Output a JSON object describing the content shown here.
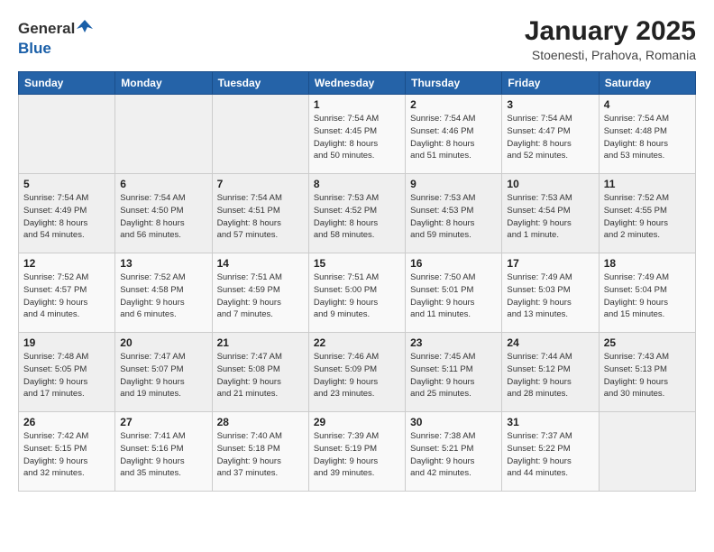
{
  "header": {
    "logo_general": "General",
    "logo_blue": "Blue",
    "title": "January 2025",
    "subtitle": "Stoenesti, Prahova, Romania"
  },
  "weekdays": [
    "Sunday",
    "Monday",
    "Tuesday",
    "Wednesday",
    "Thursday",
    "Friday",
    "Saturday"
  ],
  "weeks": [
    [
      {
        "day": "",
        "info": ""
      },
      {
        "day": "",
        "info": ""
      },
      {
        "day": "",
        "info": ""
      },
      {
        "day": "1",
        "info": "Sunrise: 7:54 AM\nSunset: 4:45 PM\nDaylight: 8 hours\nand 50 minutes."
      },
      {
        "day": "2",
        "info": "Sunrise: 7:54 AM\nSunset: 4:46 PM\nDaylight: 8 hours\nand 51 minutes."
      },
      {
        "day": "3",
        "info": "Sunrise: 7:54 AM\nSunset: 4:47 PM\nDaylight: 8 hours\nand 52 minutes."
      },
      {
        "day": "4",
        "info": "Sunrise: 7:54 AM\nSunset: 4:48 PM\nDaylight: 8 hours\nand 53 minutes."
      }
    ],
    [
      {
        "day": "5",
        "info": "Sunrise: 7:54 AM\nSunset: 4:49 PM\nDaylight: 8 hours\nand 54 minutes."
      },
      {
        "day": "6",
        "info": "Sunrise: 7:54 AM\nSunset: 4:50 PM\nDaylight: 8 hours\nand 56 minutes."
      },
      {
        "day": "7",
        "info": "Sunrise: 7:54 AM\nSunset: 4:51 PM\nDaylight: 8 hours\nand 57 minutes."
      },
      {
        "day": "8",
        "info": "Sunrise: 7:53 AM\nSunset: 4:52 PM\nDaylight: 8 hours\nand 58 minutes."
      },
      {
        "day": "9",
        "info": "Sunrise: 7:53 AM\nSunset: 4:53 PM\nDaylight: 8 hours\nand 59 minutes."
      },
      {
        "day": "10",
        "info": "Sunrise: 7:53 AM\nSunset: 4:54 PM\nDaylight: 9 hours\nand 1 minute."
      },
      {
        "day": "11",
        "info": "Sunrise: 7:52 AM\nSunset: 4:55 PM\nDaylight: 9 hours\nand 2 minutes."
      }
    ],
    [
      {
        "day": "12",
        "info": "Sunrise: 7:52 AM\nSunset: 4:57 PM\nDaylight: 9 hours\nand 4 minutes."
      },
      {
        "day": "13",
        "info": "Sunrise: 7:52 AM\nSunset: 4:58 PM\nDaylight: 9 hours\nand 6 minutes."
      },
      {
        "day": "14",
        "info": "Sunrise: 7:51 AM\nSunset: 4:59 PM\nDaylight: 9 hours\nand 7 minutes."
      },
      {
        "day": "15",
        "info": "Sunrise: 7:51 AM\nSunset: 5:00 PM\nDaylight: 9 hours\nand 9 minutes."
      },
      {
        "day": "16",
        "info": "Sunrise: 7:50 AM\nSunset: 5:01 PM\nDaylight: 9 hours\nand 11 minutes."
      },
      {
        "day": "17",
        "info": "Sunrise: 7:49 AM\nSunset: 5:03 PM\nDaylight: 9 hours\nand 13 minutes."
      },
      {
        "day": "18",
        "info": "Sunrise: 7:49 AM\nSunset: 5:04 PM\nDaylight: 9 hours\nand 15 minutes."
      }
    ],
    [
      {
        "day": "19",
        "info": "Sunrise: 7:48 AM\nSunset: 5:05 PM\nDaylight: 9 hours\nand 17 minutes."
      },
      {
        "day": "20",
        "info": "Sunrise: 7:47 AM\nSunset: 5:07 PM\nDaylight: 9 hours\nand 19 minutes."
      },
      {
        "day": "21",
        "info": "Sunrise: 7:47 AM\nSunset: 5:08 PM\nDaylight: 9 hours\nand 21 minutes."
      },
      {
        "day": "22",
        "info": "Sunrise: 7:46 AM\nSunset: 5:09 PM\nDaylight: 9 hours\nand 23 minutes."
      },
      {
        "day": "23",
        "info": "Sunrise: 7:45 AM\nSunset: 5:11 PM\nDaylight: 9 hours\nand 25 minutes."
      },
      {
        "day": "24",
        "info": "Sunrise: 7:44 AM\nSunset: 5:12 PM\nDaylight: 9 hours\nand 28 minutes."
      },
      {
        "day": "25",
        "info": "Sunrise: 7:43 AM\nSunset: 5:13 PM\nDaylight: 9 hours\nand 30 minutes."
      }
    ],
    [
      {
        "day": "26",
        "info": "Sunrise: 7:42 AM\nSunset: 5:15 PM\nDaylight: 9 hours\nand 32 minutes."
      },
      {
        "day": "27",
        "info": "Sunrise: 7:41 AM\nSunset: 5:16 PM\nDaylight: 9 hours\nand 35 minutes."
      },
      {
        "day": "28",
        "info": "Sunrise: 7:40 AM\nSunset: 5:18 PM\nDaylight: 9 hours\nand 37 minutes."
      },
      {
        "day": "29",
        "info": "Sunrise: 7:39 AM\nSunset: 5:19 PM\nDaylight: 9 hours\nand 39 minutes."
      },
      {
        "day": "30",
        "info": "Sunrise: 7:38 AM\nSunset: 5:21 PM\nDaylight: 9 hours\nand 42 minutes."
      },
      {
        "day": "31",
        "info": "Sunrise: 7:37 AM\nSunset: 5:22 PM\nDaylight: 9 hours\nand 44 minutes."
      },
      {
        "day": "",
        "info": ""
      }
    ]
  ]
}
